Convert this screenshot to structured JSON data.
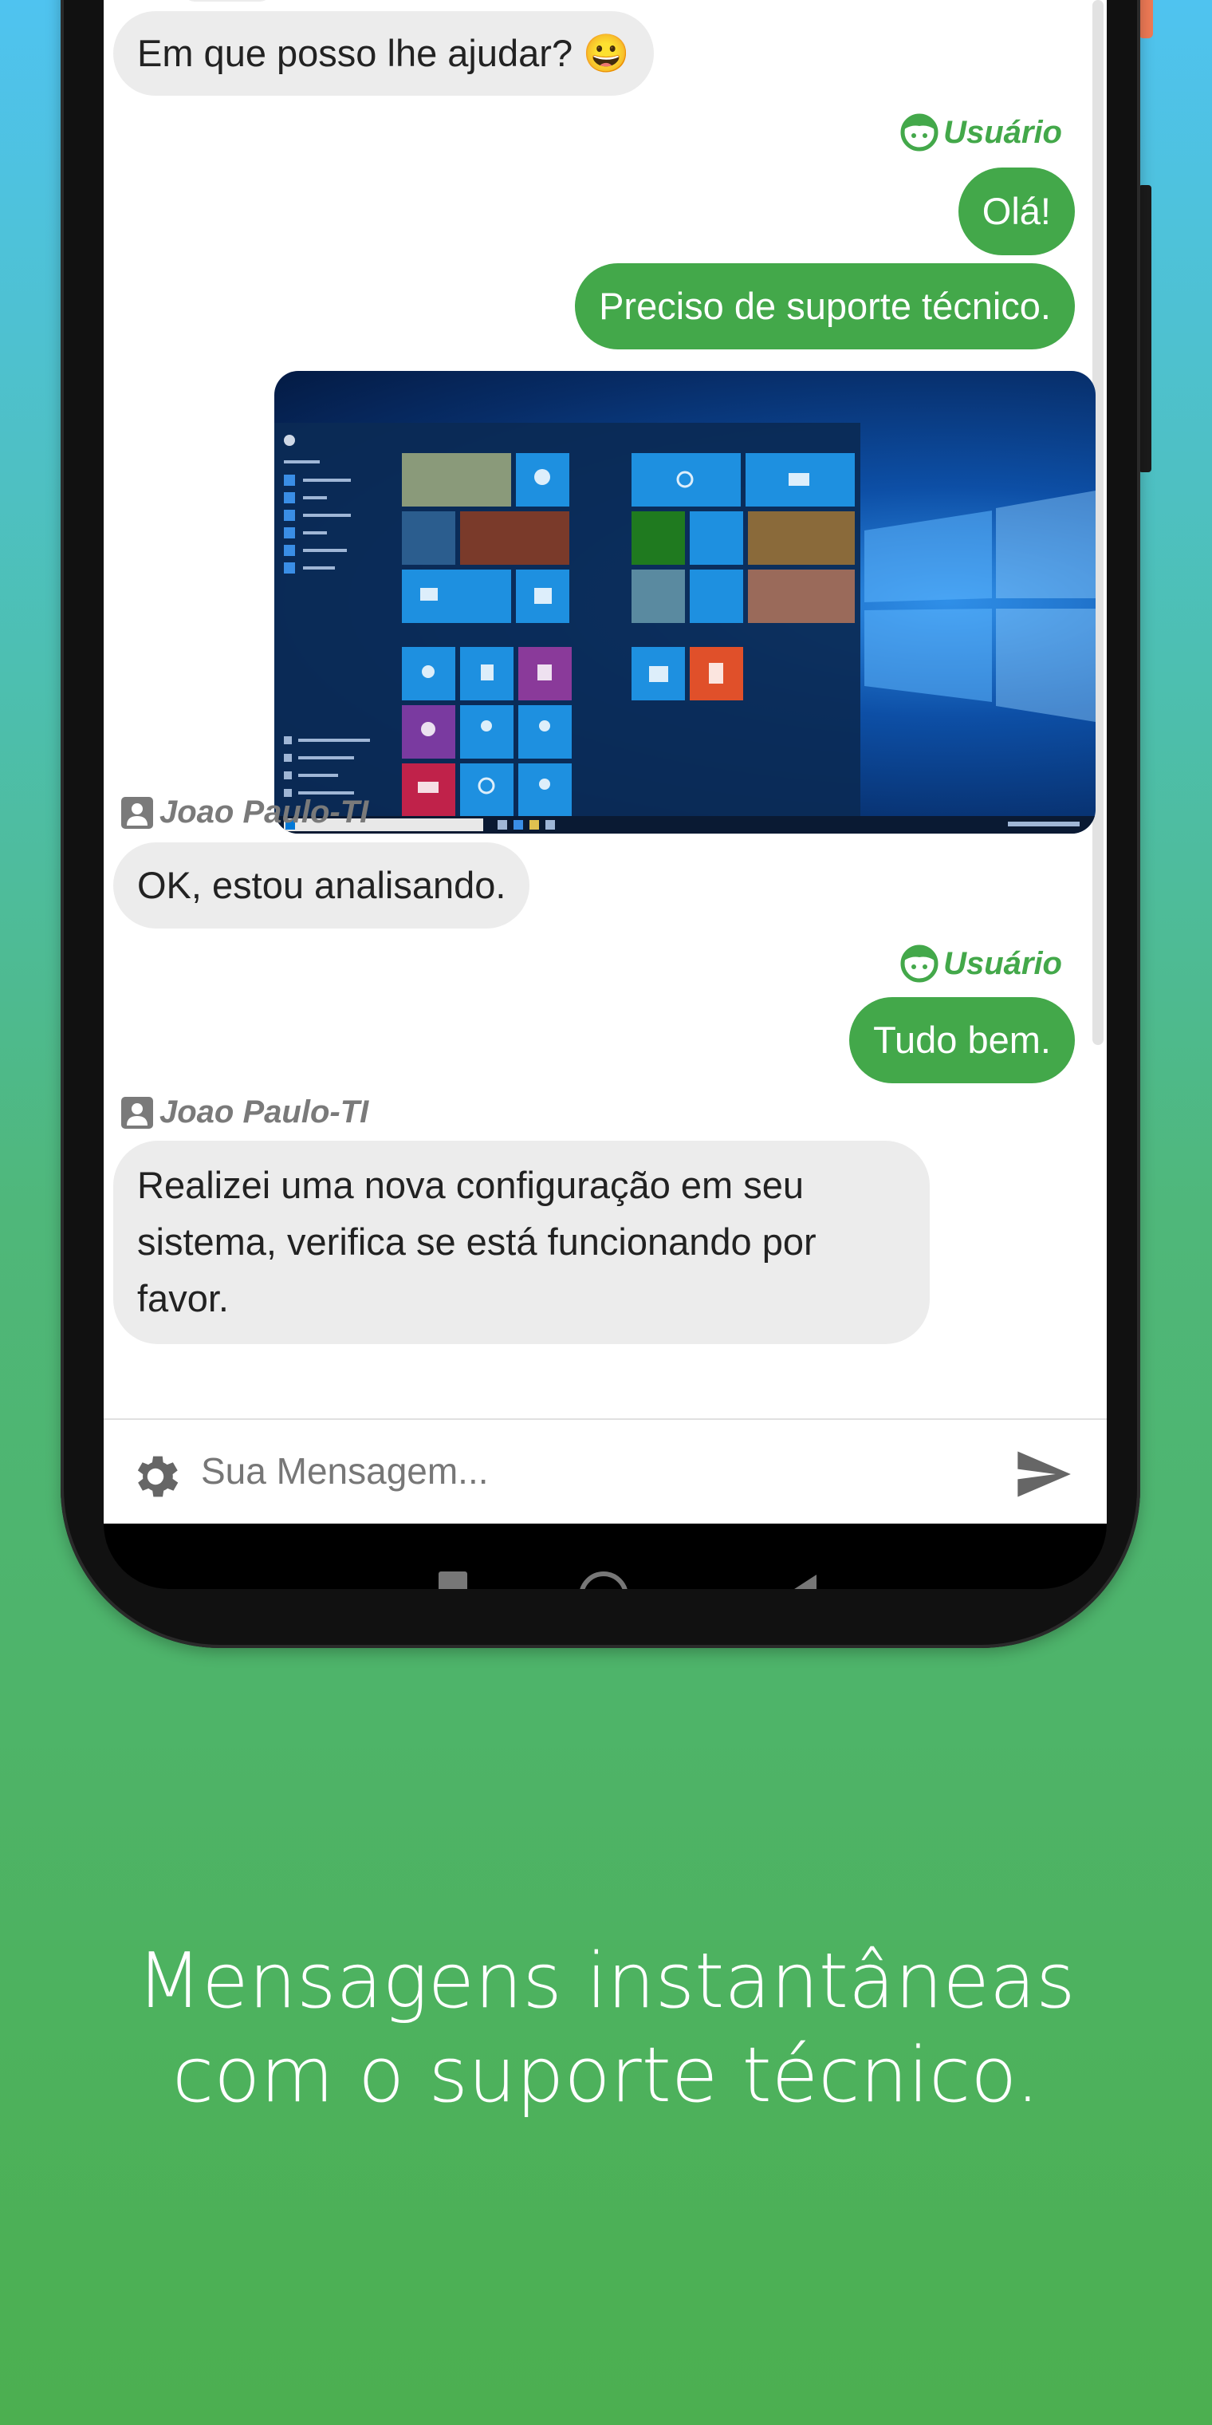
{
  "messages": {
    "greeting": "Em que posso lhe ajudar? 😀",
    "user_label_1": "Usuário",
    "ola": "Olá!",
    "suporte": "Preciso de suporte técnico.",
    "agent_label_1": "Joao Paulo-TI",
    "analisando": "OK, estou analisando.",
    "user_label_2": "Usuário",
    "tudo_bem": "Tudo bem.",
    "agent_label_2": "Joao Paulo-TI",
    "config": "Realizei uma nova configuração em seu sistema, verifica se está funcionando por favor."
  },
  "composer": {
    "placeholder": "Sua Mensagem..."
  },
  "tagline": {
    "line1": "Mensagens instantâneas",
    "line2": "com o suporte técnico."
  },
  "colors": {
    "accent_green": "#43a84a",
    "incoming_bubble": "#ececec"
  },
  "icons": [
    "gear-icon",
    "send-icon",
    "user-face-icon",
    "contact-card-icon"
  ]
}
